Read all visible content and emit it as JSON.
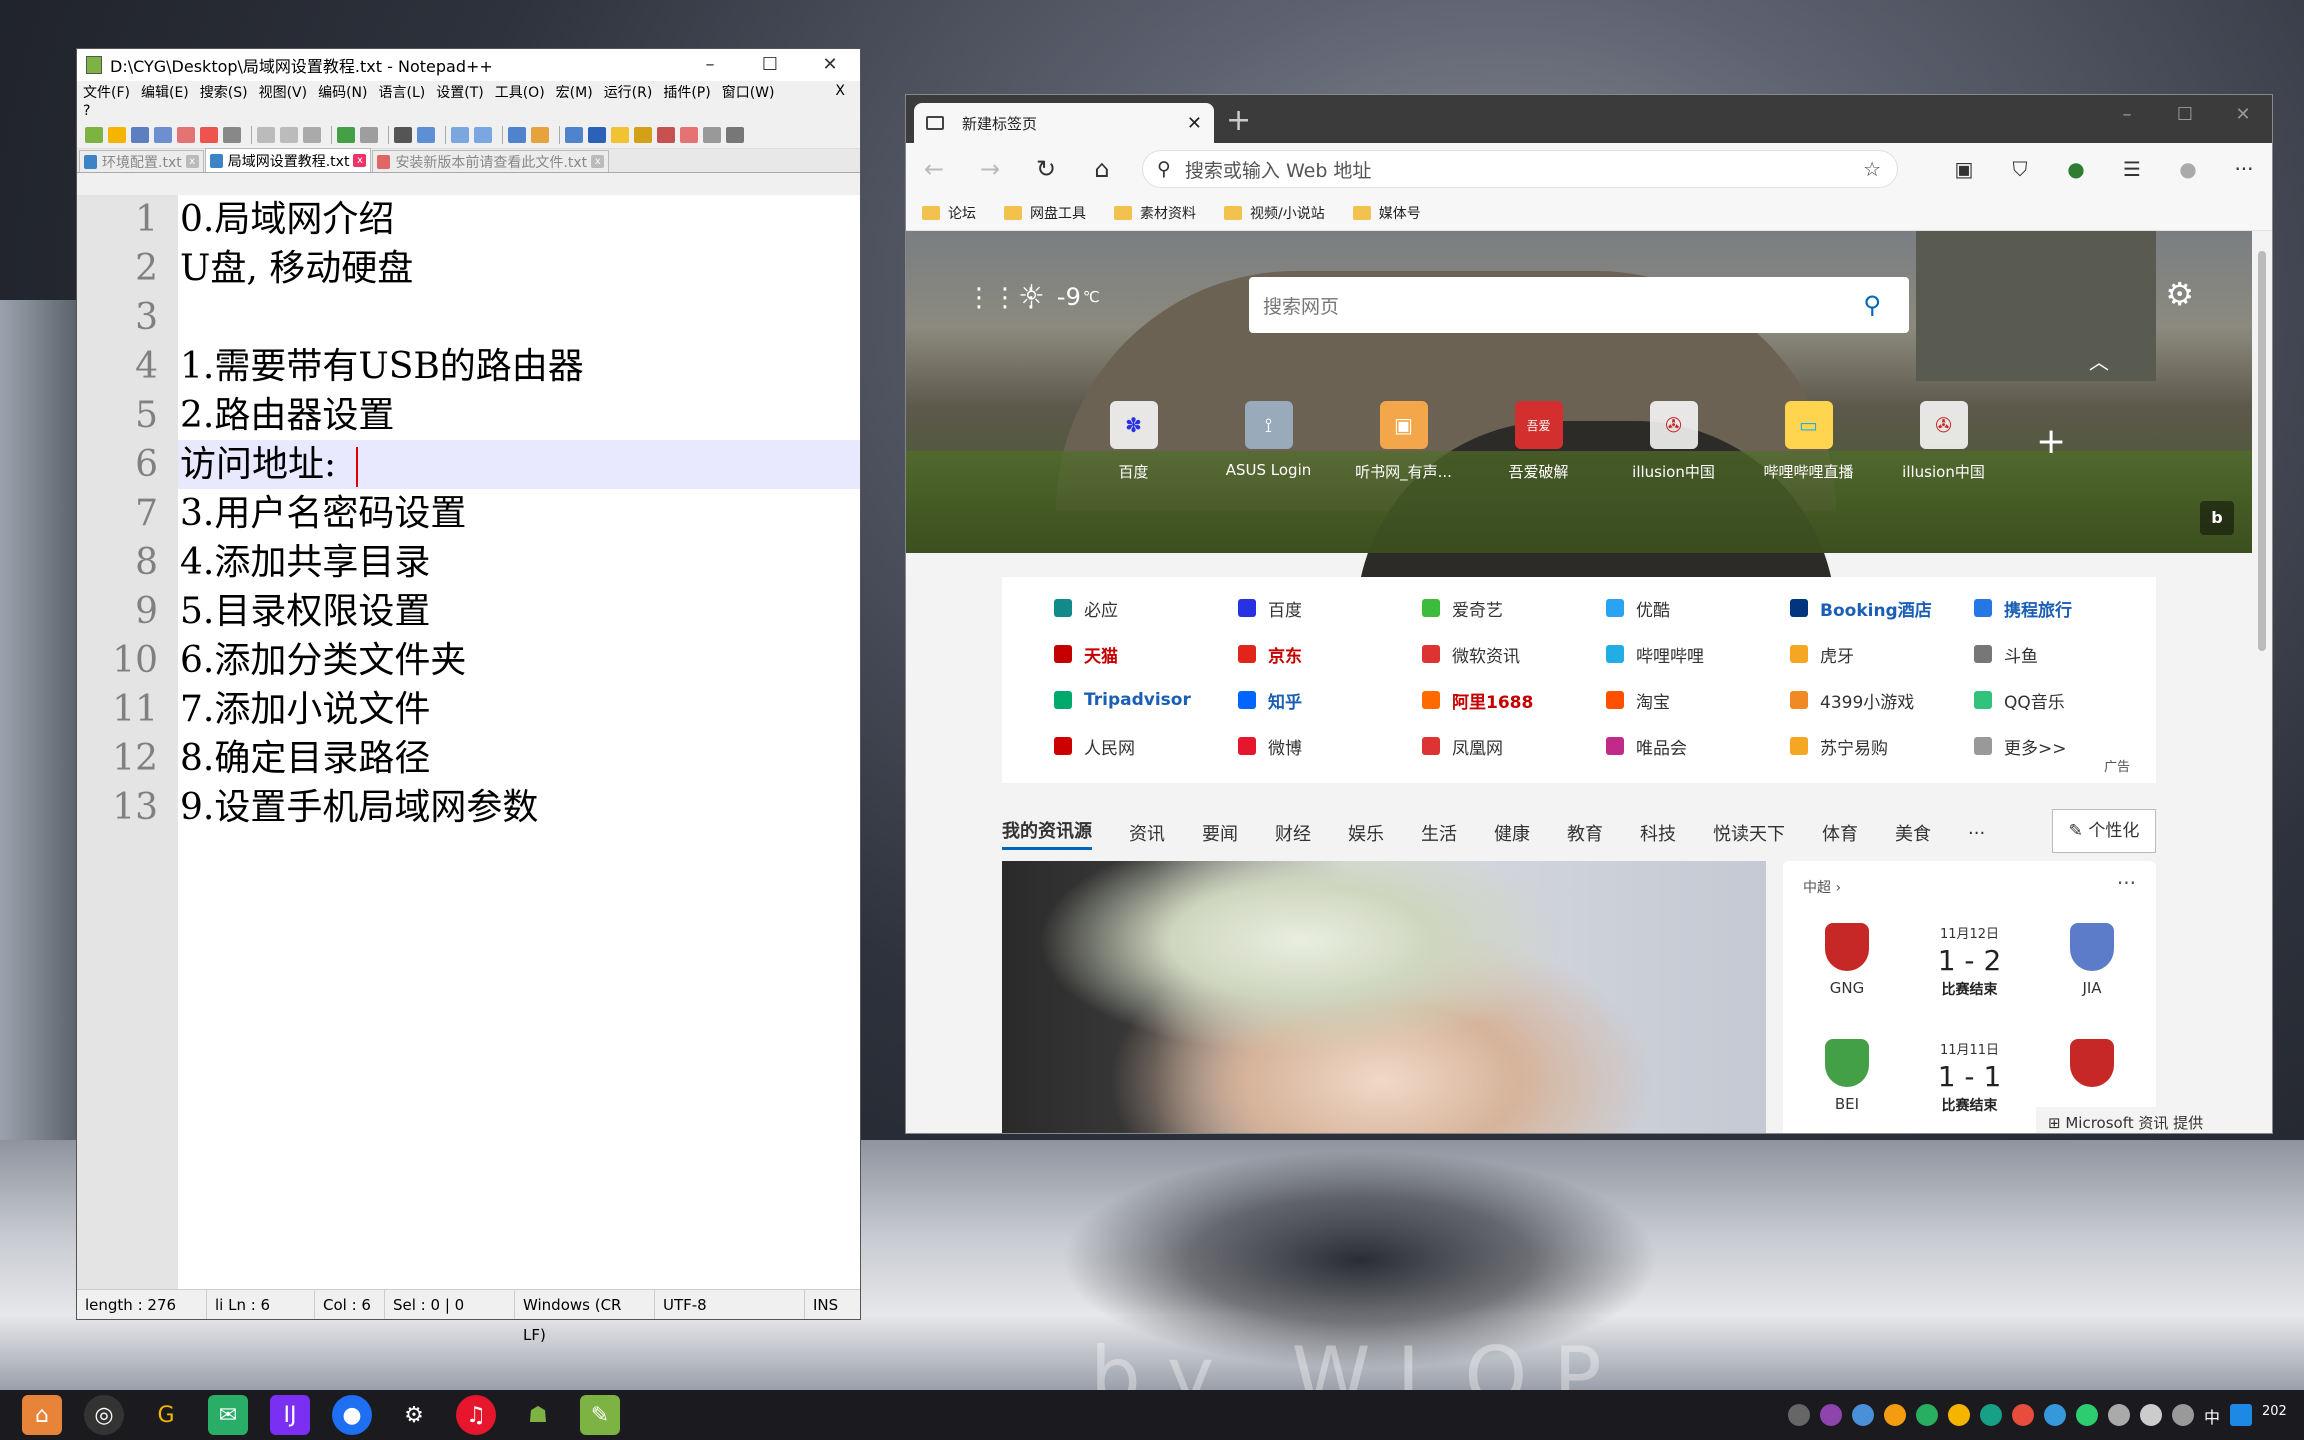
{
  "notepad": {
    "title": "D:\\CYG\\Desktop\\局域网设置教程.txt - Notepad++",
    "menu": [
      "文件(F)",
      "编辑(E)",
      "搜索(S)",
      "视图(V)",
      "编码(N)",
      "语言(L)",
      "设置(T)",
      "工具(O)",
      "宏(M)",
      "运行(R)",
      "插件(P)",
      "窗口(W)"
    ],
    "menu_close": "X",
    "help": "?",
    "tabs": [
      {
        "label": "环境配置.txt"
      },
      {
        "label": "局域网设置教程.txt",
        "active": true
      },
      {
        "label": "安装新版本前请查看此文件.txt"
      }
    ],
    "line_numbers": [
      "1",
      "2",
      "3",
      "4",
      "5",
      "6",
      "7",
      "8",
      "9",
      "10",
      "11",
      "12",
      "13"
    ],
    "lines": [
      "0.局域网介绍",
      "U盘, 移动硬盘",
      "",
      "1.需要带有USB的路由器",
      "2.路由器设置",
      "访问地址:",
      "3.用户名密码设置",
      "4.添加共享目录",
      "5.目录权限设置",
      "6.添加分类文件夹",
      "7.添加小说文件",
      "8.确定目录路径",
      "9.设置手机局域网参数"
    ],
    "current_line": 6,
    "status": {
      "length": "length : 276",
      "pos": "li Ln : 6",
      "col": "Col : 6",
      "sel": "Sel : 0 | 0",
      "eol": "Windows (CR LF)",
      "enc": "UTF-8",
      "mode": "INS"
    }
  },
  "edge": {
    "tab_title": "新建标签页",
    "address_placeholder": "搜索或输入 Web 地址",
    "bookmarks": [
      "论坛",
      "网盘工具",
      "素材资料",
      "视频/小说站",
      "媒体号"
    ],
    "weather": "-9",
    "weather_unit": "℃",
    "search_placeholder": "搜索网页",
    "tiles": [
      "百度",
      "ASUS Login",
      "听书网_有声...",
      "吾爱破解",
      "illusion中国",
      "哔哩哔哩直播",
      "illusion中国"
    ],
    "quick_links": [
      {
        "label": "必应",
        "color": "#138a8a"
      },
      {
        "label": "百度",
        "color": "#2932e1"
      },
      {
        "label": "爱奇艺",
        "color": "#3dbb3d"
      },
      {
        "label": "优酷",
        "color": "#2aa3f3"
      },
      {
        "label": "Booking酒店",
        "color": "#003580",
        "bold": true,
        "text_color": "#1a5fb4"
      },
      {
        "label": "携程旅行",
        "color": "#2577e3",
        "bold": true,
        "text_color": "#1a5fb4"
      },
      {
        "label": "天猫",
        "color": "#c40000",
        "bold": true,
        "text_color": "#c40000"
      },
      {
        "label": "京东",
        "color": "#e1251b",
        "bold": true,
        "text_color": "#c40000"
      },
      {
        "label": "微软资讯",
        "color": "#d33",
        "text_color": "#333"
      },
      {
        "label": "哔哩哔哩",
        "color": "#23ade5"
      },
      {
        "label": "虎牙",
        "color": "#f5a623"
      },
      {
        "label": "斗鱼",
        "color": "#777"
      },
      {
        "label": "Tripadvisor",
        "color": "#00aa6c",
        "bold": true,
        "text_color": "#1a5fb4"
      },
      {
        "label": "知乎",
        "color": "#0066ff",
        "bold": true,
        "text_color": "#1a5fb4"
      },
      {
        "label": "阿里1688",
        "color": "#ff6a00",
        "bold": true,
        "text_color": "#c40000"
      },
      {
        "label": "淘宝",
        "color": "#ff5000"
      },
      {
        "label": "4399小游戏",
        "color": "#f08a24"
      },
      {
        "label": "QQ音乐",
        "color": "#31c27c"
      },
      {
        "label": "人民网",
        "color": "#c00"
      },
      {
        "label": "微博",
        "color": "#e6162d"
      },
      {
        "label": "凤凰网",
        "color": "#d33"
      },
      {
        "label": "唯品会",
        "color": "#c22a8a"
      },
      {
        "label": "苏宁易购",
        "color": "#f5a623"
      },
      {
        "label": "更多>>",
        "color": "#999"
      }
    ],
    "ad_label": "广告",
    "news_tabs": [
      "我的资讯源",
      "资讯",
      "要闻",
      "财经",
      "娱乐",
      "生活",
      "健康",
      "教育",
      "科技",
      "悦读天下",
      "体育",
      "美食",
      "···"
    ],
    "personalize": "个性化",
    "sports": {
      "league": "中超",
      "more": "···",
      "matches": [
        {
          "date": "11月12日",
          "score": "1 - 2",
          "status": "比赛结束",
          "home": "GNG",
          "away": "JIA",
          "home_color": "#c62828",
          "away_color": "#5c7cc9"
        },
        {
          "date": "11月11日",
          "score": "1 - 1",
          "status": "比赛结束",
          "home": "BEI",
          "away": "",
          "home_color": "#43a047",
          "away_color": "#c62828"
        }
      ]
    },
    "msn_credit": "Microsoft 资讯 提供"
  },
  "taskbar": {
    "lang": "中",
    "clock": "202"
  },
  "wallpaper_sig": "by WLOP"
}
